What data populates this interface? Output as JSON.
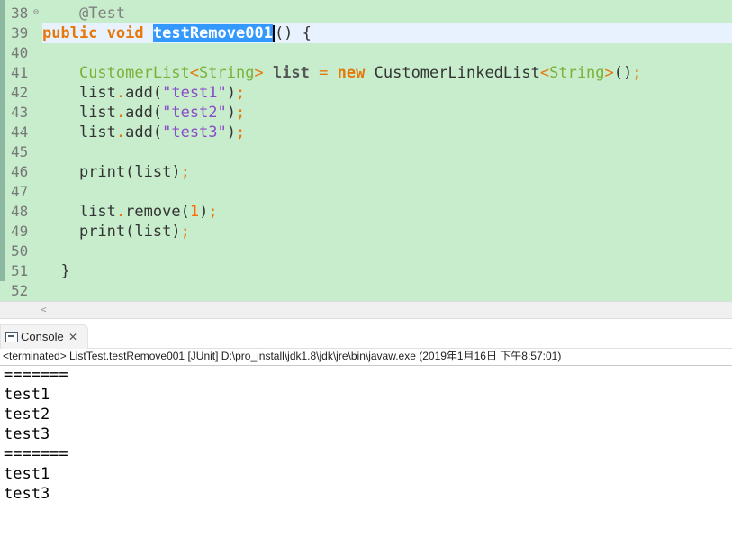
{
  "editor": {
    "line_numbers": [
      "38",
      "39",
      "40",
      "41",
      "42",
      "43",
      "44",
      "45",
      "46",
      "47",
      "48",
      "49",
      "50",
      "51",
      "52"
    ],
    "fold_marker": "⊖",
    "line38": {
      "annotation": "@Test"
    },
    "line39": {
      "kw_public": "public",
      "kw_void": "void",
      "method_name": "testRemove001",
      "tail": "() {"
    },
    "line41": {
      "type": "CustomerList",
      "lt": "<",
      "generic": "String",
      "gt": ">",
      "var": "list",
      "eq": "=",
      "kw_new": "new",
      "impl": "CustomerLinkedList",
      "lt2": "<",
      "generic2": "String",
      "gt2": ">",
      "parens": "()",
      "semi": ";"
    },
    "line42": {
      "obj": "list",
      "dot": ".",
      "method": "add",
      "open": "(",
      "arg": "\"test1\"",
      "close": ")",
      "semi": ";"
    },
    "line43": {
      "obj": "list",
      "dot": ".",
      "method": "add",
      "open": "(",
      "arg": "\"test2\"",
      "close": ")",
      "semi": ";"
    },
    "line44": {
      "obj": "list",
      "dot": ".",
      "method": "add",
      "open": "(",
      "arg": "\"test3\"",
      "close": ")",
      "semi": ";"
    },
    "line46": {
      "method": "print",
      "open": "(",
      "arg": "list",
      "close": ")",
      "semi": ";"
    },
    "line48": {
      "obj": "list",
      "dot": ".",
      "method": "remove",
      "open": "(",
      "arg": "1",
      "close": ")",
      "semi": ";"
    },
    "line49": {
      "method": "print",
      "open": "(",
      "arg": "list",
      "close": ")",
      "semi": ";"
    },
    "line51": {
      "brace": "}"
    },
    "hscroll_arrow": "<"
  },
  "console": {
    "tab_label": "Console",
    "close_glyph": "✕",
    "status": "<terminated> ListTest.testRemove001 [JUnit] D:\\pro_install\\jdk1.8\\jdk\\jre\\bin\\javaw.exe (2019年1月16日 下午8:57:01)",
    "output": [
      "=======",
      "test1",
      "test2",
      "test3",
      "=======",
      "test1",
      "test3"
    ]
  },
  "colors": {
    "editor_bg": "#c7edcc",
    "current_line": "#e8f2fe",
    "selection": "#3399ff",
    "keyword": "#e6780a",
    "type": "#7bb13a",
    "string": "#8b4bc9"
  }
}
